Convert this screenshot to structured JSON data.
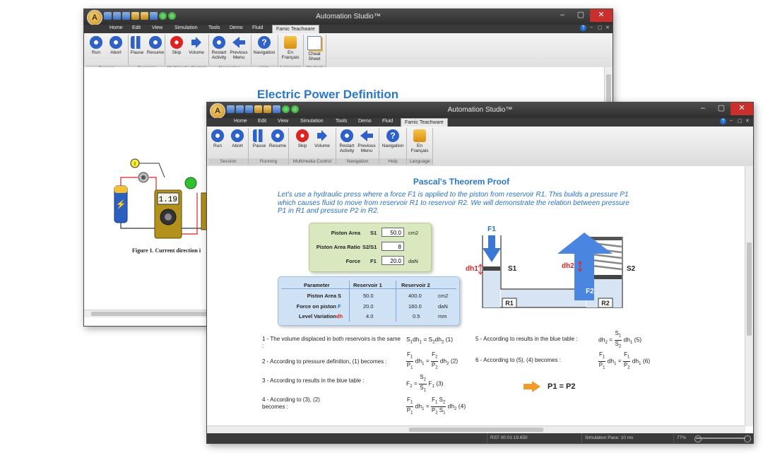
{
  "back_window": {
    "title": "Automation Studio™",
    "menu": [
      "Home",
      "Edit",
      "View",
      "Simulation",
      "Tools",
      "Demo",
      "Fluid",
      "Famic Teachware"
    ],
    "ribbon_groups": [
      {
        "caption": "Session",
        "buttons": [
          {
            "label": "Run",
            "icon": "gear-icon"
          },
          {
            "label": "Abort",
            "icon": "gear-icon"
          }
        ]
      },
      {
        "caption": "Running",
        "buttons": [
          {
            "label": "Pause",
            "icon": "pause-icon"
          },
          {
            "label": "Resume",
            "icon": "gear-icon"
          }
        ]
      },
      {
        "caption": "Multimedia Control",
        "buttons": [
          {
            "label": "Skip",
            "icon": "skip-icon"
          },
          {
            "label": "Volume",
            "icon": "speaker-icon"
          }
        ]
      },
      {
        "caption": "Navigation",
        "buttons": [
          {
            "label": "Restart Activity",
            "icon": "gear-icon"
          },
          {
            "label": "Previous Menu",
            "icon": "back-arrow-icon"
          }
        ]
      },
      {
        "caption": "Help",
        "buttons": [
          {
            "label": "Navigation",
            "icon": "help-icon"
          }
        ]
      },
      {
        "caption": "Language",
        "buttons": [
          {
            "label": "En Français",
            "icon": "language-icon"
          }
        ]
      },
      {
        "caption": "Student",
        "buttons": [
          {
            "label": "Cheat Sheet",
            "icon": "cheat-sheet-icon"
          }
        ]
      }
    ],
    "page_title": "Electric Power Definition",
    "meter_reading": "1.19",
    "current_marker": "I",
    "figure_caption": "Figure 1. Current direction i"
  },
  "front_window": {
    "title": "Automation Studio™",
    "menu": [
      "Home",
      "Edit",
      "View",
      "Simulation",
      "Tools",
      "Demo",
      "Fluid",
      "Famic Teachware"
    ],
    "active_tab": "Famic Teachware",
    "ribbon_groups": [
      {
        "caption": "Session",
        "buttons": [
          {
            "label": "Run",
            "icon": "gear-icon"
          },
          {
            "label": "Abort",
            "icon": "gear-icon"
          }
        ]
      },
      {
        "caption": "Running",
        "buttons": [
          {
            "label": "Pause",
            "icon": "pause-icon"
          },
          {
            "label": "Resume",
            "icon": "gear-icon"
          }
        ]
      },
      {
        "caption": "Multimedia Control",
        "buttons": [
          {
            "label": "Skip",
            "icon": "skip-icon"
          },
          {
            "label": "Volume",
            "icon": "speaker-icon"
          }
        ]
      },
      {
        "caption": "Navigation",
        "buttons": [
          {
            "label": "Restart Activity",
            "icon": "gear-icon"
          },
          {
            "label": "Previous Menu",
            "icon": "back-arrow-icon"
          }
        ]
      },
      {
        "caption": "Help",
        "buttons": [
          {
            "label": "Navigation",
            "icon": "help-icon"
          }
        ]
      },
      {
        "caption": "Language",
        "buttons": [
          {
            "label": "En Français",
            "icon": "language-icon"
          }
        ]
      }
    ],
    "page_title": "Pascal's Theorem Proof",
    "intro": "Let's use a hydraulic press where a force F1 is applied to the piston from reservoir R1. This builds a pressure P1 which causes fluid to move from reservoir R1 to reservoir R2. We will demonstrate the relation between pressure P1 in R1 and pressure P2 in R2.",
    "inputs": [
      {
        "label": "Piston Area",
        "symbol": "S1",
        "value": "50.0",
        "unit": "cm2"
      },
      {
        "label": "Piston Area Ratio",
        "symbol": "S2/S1",
        "value": "8",
        "unit": ""
      },
      {
        "label": "Force",
        "symbol": "F1",
        "value": "20.0",
        "unit": "daN"
      }
    ],
    "table": {
      "headers": [
        "Parameter",
        "Reservoir  1",
        "Reservoir 2"
      ],
      "rows": [
        {
          "param": "Piston Area",
          "sym": "S",
          "r1": "50.0",
          "r2": "400.0",
          "unit": "cm2"
        },
        {
          "param": "Force on piston",
          "sym": "F",
          "r1": "20.0",
          "r2": "160.0",
          "unit": "daN"
        },
        {
          "param": "Level Variation",
          "sym": "dh",
          "r1": "4.0",
          "r2": "0.5",
          "unit": "mm"
        }
      ]
    },
    "diagram": {
      "F1": "F1",
      "F2": "F2",
      "S1": "S1",
      "S2": "S2",
      "R1": "R1",
      "R2": "R2",
      "dh1": "dh1",
      "dh2": "dh2"
    },
    "steps": {
      "s1": "1 - The volume displaced in both reservoirs is the same :",
      "s2": "2 - According to pressure definition, (1) becomes :",
      "s3": "3 - According to results in the blue table :",
      "s4": "4 - According to (3), (2) becomes :",
      "s5": "5 - According to results in the blue table :",
      "s6": "6 - According to (5), (4) becomes :"
    },
    "eq_tags": {
      "e1": "(1)",
      "e2": "(2)",
      "e3": "(3)",
      "e4": "(4)",
      "e5": "(5)",
      "e6": "(6)"
    },
    "result": "P1 = P2",
    "status": {
      "time": "RST 00:01:19.650",
      "pace": "Simulation Pace: 10 ms",
      "zoom": "77%"
    }
  }
}
